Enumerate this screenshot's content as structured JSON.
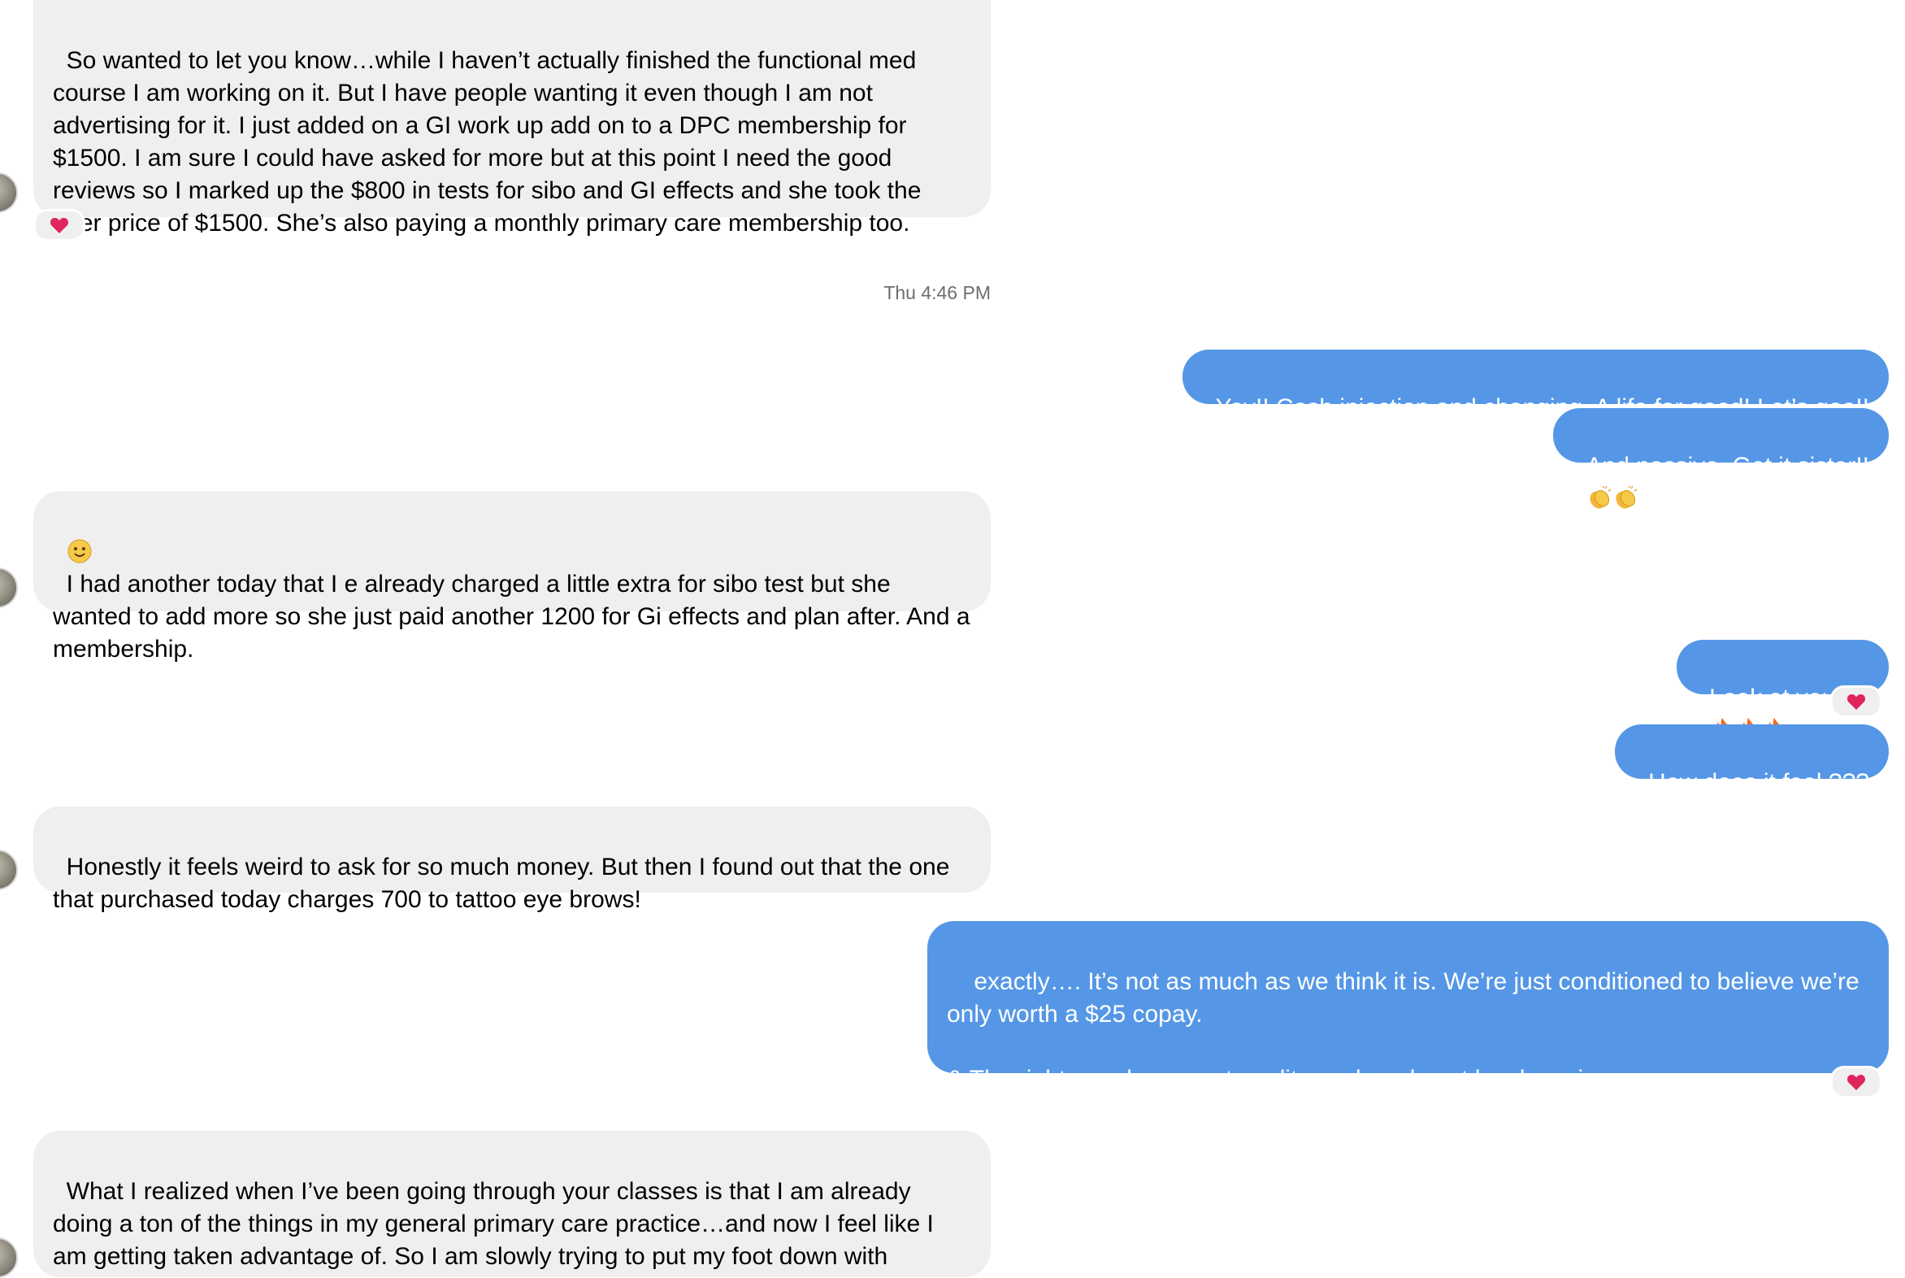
{
  "conversation": {
    "messages": [
      {
        "id": "m1",
        "direction": "incoming",
        "text": "So wanted to let you know…while I haven’t actually finished the functional med course I am working on it. But I have people wanting it even though I am not advertising for it. I just added on a GI work up add on to a DPC membership for $1500. I am sure I could have asked for more but at this point I need the good reviews so I marked up the $800 in tests for sibo and GI effects and she took the offer price of $1500. She’s also paying a monthly primary care membership too.",
        "reaction": "heart"
      },
      {
        "id": "t1",
        "type": "timestamp",
        "text": "Thu 4:46 PM"
      },
      {
        "id": "m2",
        "direction": "outgoing",
        "text": "Yay!! Cash injection and changing. A life for good! Let’s goo!!"
      },
      {
        "id": "m3",
        "direction": "outgoing",
        "text": "And passive. Get it sister!!",
        "emoji": [
          "clapping-hands",
          "clapping-hands"
        ]
      },
      {
        "id": "m4",
        "direction": "incoming",
        "emoji_prefix": "slightly-smiling-face",
        "text": "I had another today that I e already charged a little extra for sibo test but she wanted to add more so she just paid another 1200 for Gi effects and plan after. And a membership."
      },
      {
        "id": "m5",
        "direction": "outgoing",
        "text": "Look at you on",
        "emoji": [
          "fire",
          "fire",
          "fire"
        ],
        "reaction": "heart"
      },
      {
        "id": "m6",
        "direction": "outgoing",
        "text": "How does it feel ???"
      },
      {
        "id": "m7",
        "direction": "incoming",
        "text": "Honestly it feels weird to ask for so much money. But then I found out that the one that purchased today charges 700 to tattoo eye brows!"
      },
      {
        "id": "m8",
        "direction": "outgoing",
        "text": "  exactly…. It’s not as much as we think it is. We’re just conditioned to believe we’re only worth a $25 copay.\n\n& The right people respect quality work and next level service.",
        "reaction": "heart"
      },
      {
        "id": "m9",
        "direction": "incoming",
        "text": "What I realized when I’ve been going through your classes is that I am already doing a ton of the things in my general primary care practice…and now I feel like I am getting taken advantage of. So I am slowly trying to put my foot down with"
      }
    ]
  },
  "colors": {
    "incoming_bubble": "#efefef",
    "outgoing_bubble": "#5597e6",
    "heart": "#e0245e"
  }
}
